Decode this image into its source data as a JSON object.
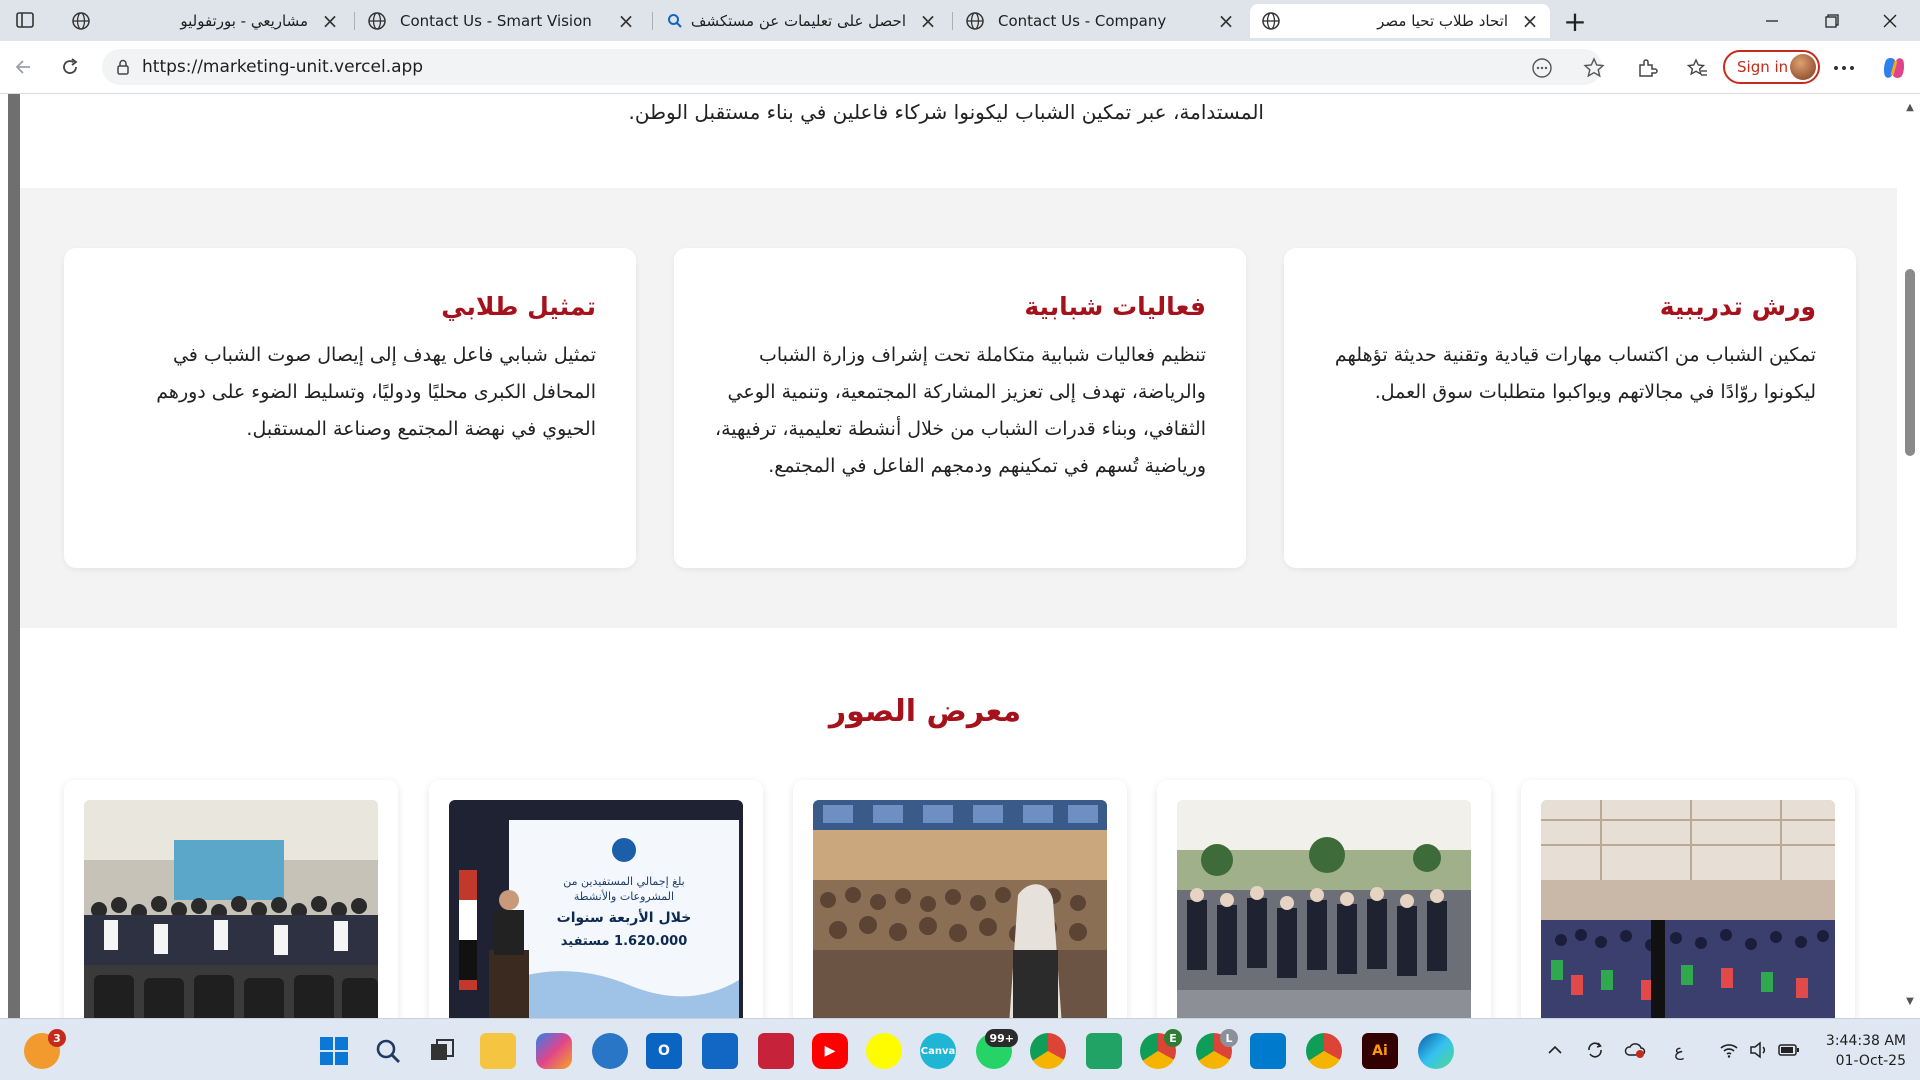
{
  "browser": {
    "tabs": [
      {
        "title": "مشاريعي - بورتفوليو",
        "rtl": true,
        "favicon": "globe-icon",
        "active": false
      },
      {
        "title": "Contact Us - Smart Vision",
        "rtl": false,
        "favicon": "globe-icon",
        "active": false
      },
      {
        "title": "احصل على تعليمات عن مستكشف الملفات في",
        "rtl": true,
        "favicon": "search-icon",
        "active": false
      },
      {
        "title": "Contact Us - Company",
        "rtl": false,
        "favicon": "globe-icon",
        "active": false
      },
      {
        "title": "اتحاد طلاب تحيا مصر",
        "rtl": true,
        "favicon": "globe-icon",
        "active": true
      }
    ],
    "url": "https://marketing-unit.vercel.app",
    "signin_label": "Sign in"
  },
  "page": {
    "intro_text": "المستدامة، عبر تمكين الشباب ليكونوا شركاء فاعلين في بناء مستقبل الوطن.",
    "cards": [
      {
        "title": "ورش تدريبية",
        "text": "تمكين الشباب من اكتساب مهارات قيادية وتقنية حديثة تؤهلهم ليكونوا روّادًا في مجالاتهم ويواكبوا متطلبات سوق العمل."
      },
      {
        "title": "فعاليات شبابية",
        "text": "تنظيم فعاليات شبابية متكاملة تحت إشراف وزارة الشباب والرياضة، تهدف إلى تعزيز المشاركة المجتمعية، وتنمية الوعي الثقافي، وبناء قدرات الشباب من خلال أنشطة تعليمية، ترفيهية، ورياضية تُسهم في تمكينهم ودمجهم الفاعل في المجتمع."
      },
      {
        "title": "تمثيل طلابي",
        "text": "تمثيل شبابي فاعل يهدف إلى إيصال صوت الشباب في المحافل الكبرى محليًا ودوليًا، وتسليط الضوء على دورهم الحيوي في نهضة المجتمع وصناعة المستقبل."
      }
    ],
    "gallery_title": "معرض الصور",
    "gallery_photos": [
      {
        "alt": "photo-conference-hall"
      },
      {
        "alt": "photo-outdoor-event"
      },
      {
        "alt": "photo-auditorium-audience"
      },
      {
        "alt": "photo-stage-banner",
        "banner_lines": [
          "بلغ إجمالي المستفيدين من",
          "المشروعات والأنشطة",
          "خلال الأربعة سنوات",
          "1.620.000 مستفيد"
        ]
      },
      {
        "alt": "photo-group-picture"
      }
    ]
  },
  "taskbar": {
    "notification_badge": "3",
    "whatsapp_badge": "99+",
    "chrome_badge_1": "E",
    "chrome_badge_2": "L",
    "lang_indicator": "ع",
    "time": "3:44:38 AM",
    "date": "01-Oct-25"
  },
  "colors": {
    "accent": "#a5121b",
    "band_bg": "#f3f3f3",
    "tabstrip_bg": "#dfe4ea",
    "taskbar_bg": "#dfe8f2"
  }
}
